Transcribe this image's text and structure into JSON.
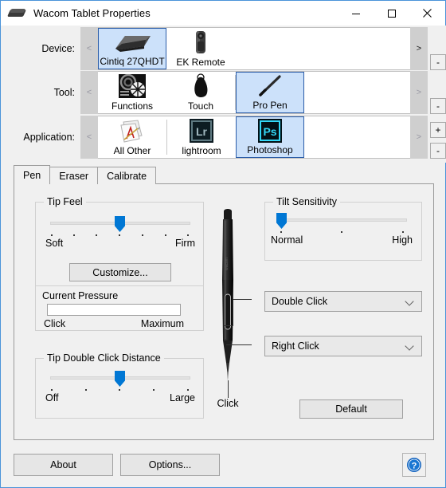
{
  "window": {
    "title": "Wacom Tablet Properties",
    "icon": "tablet-icon",
    "minimize": "minimize-icon",
    "maximize": "maximize-icon",
    "close": "close-icon",
    "accent_border": "#4a93d9",
    "selection_fill": "#cce1fa",
    "selection_border": "#2a5ca8",
    "slider_color": "#0077d4"
  },
  "selectors": {
    "device": {
      "label": "Device:",
      "prev": "<",
      "next": ">",
      "prev_enabled": false,
      "next_enabled": true,
      "minus": "-",
      "items": [
        {
          "label": "Cintiq 27QHDT",
          "icon": "cintiq-tablet-icon",
          "selected": true
        },
        {
          "label": "EK Remote",
          "icon": "ek-remote-icon",
          "selected": false
        }
      ]
    },
    "tool": {
      "label": "Tool:",
      "prev": "<",
      "next": ">",
      "prev_enabled": false,
      "next_enabled": false,
      "minus": "-",
      "items": [
        {
          "label": "Functions",
          "icon": "functions-icon",
          "selected": false
        },
        {
          "label": "Touch",
          "icon": "touch-icon",
          "selected": false
        },
        {
          "label": "Pro Pen",
          "icon": "pro-pen-icon",
          "selected": true
        }
      ]
    },
    "application": {
      "label": "Application:",
      "prev": "<",
      "next": ">",
      "prev_enabled": false,
      "next_enabled": false,
      "plus": "+",
      "minus": "-",
      "items": [
        {
          "label": "All Other",
          "icon": "all-other-icon",
          "selected": false
        },
        {
          "label": "lightroom",
          "icon": "lightroom-icon",
          "selected": false
        },
        {
          "label": "Photoshop",
          "icon": "photoshop-icon",
          "selected": true
        }
      ]
    }
  },
  "tabs": [
    {
      "label": "Pen",
      "active": true
    },
    {
      "label": "Eraser",
      "active": false
    },
    {
      "label": "Calibrate",
      "active": false
    }
  ],
  "tip_feel": {
    "title": "Tip Feel",
    "min_label": "Soft",
    "max_label": "Firm",
    "ticks": 7,
    "value_index": 3,
    "customize_label": "Customize..."
  },
  "current_pressure": {
    "title": "Current Pressure",
    "min_label": "Click",
    "max_label": "Maximum",
    "value_percent": 0
  },
  "tip_double_click_distance": {
    "title": "Tip Double Click Distance",
    "min_label": "Off",
    "max_label": "Large",
    "ticks": 5,
    "value_index": 2
  },
  "tilt_sensitivity": {
    "title": "Tilt Sensitivity",
    "min_label": "Normal",
    "max_label": "High",
    "ticks": 3,
    "value_index": 0
  },
  "pen": {
    "image_name": "wacom-pro-pen-illustration",
    "tip_label": "Click",
    "upper_switch_value": "Double Click",
    "lower_switch_value": "Right Click"
  },
  "buttons": {
    "default": "Default",
    "about": "About",
    "options": "Options...",
    "help": "?"
  }
}
